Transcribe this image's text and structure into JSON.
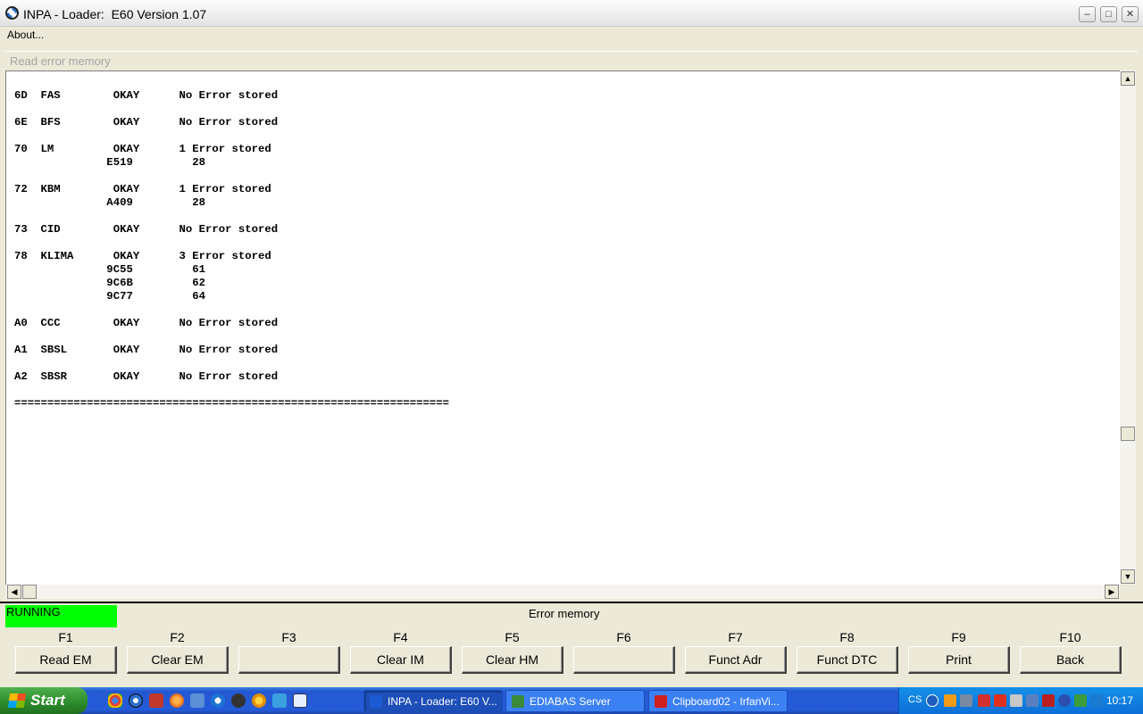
{
  "window": {
    "title": "INPA - Loader:  E60 Version 1.07"
  },
  "menu": {
    "about": "About..."
  },
  "panel": {
    "title": "Read error memory"
  },
  "output_lines": [
    "6D  FAS        OKAY      No Error stored",
    "",
    "6E  BFS        OKAY      No Error stored",
    "",
    "70  LM         OKAY      1 Error stored",
    "              E519         28",
    "",
    "72  KBM        OKAY      1 Error stored",
    "              A409         28",
    "",
    "73  CID        OKAY      No Error stored",
    "",
    "78  KLIMA      OKAY      3 Error stored",
    "              9C55         61",
    "              9C6B         62",
    "              9C77         64",
    "",
    "A0  CCC        OKAY      No Error stored",
    "",
    "A1  SBSL       OKAY      No Error stored",
    "",
    "A2  SBSR       OKAY      No Error stored",
    "",
    "=================================================================="
  ],
  "status": {
    "state": "RUNNING",
    "title": "Error memory"
  },
  "function_keys": [
    {
      "key": "F1",
      "label": "Read EM"
    },
    {
      "key": "F2",
      "label": "Clear EM"
    },
    {
      "key": "F3",
      "label": ""
    },
    {
      "key": "F4",
      "label": "Clear IM"
    },
    {
      "key": "F5",
      "label": "Clear HM"
    },
    {
      "key": "F6",
      "label": ""
    },
    {
      "key": "F7",
      "label": "Funct Adr"
    },
    {
      "key": "F8",
      "label": "Funct DTC"
    },
    {
      "key": "F9",
      "label": "Print"
    },
    {
      "key": "F10",
      "label": "Back"
    }
  ],
  "taskbar": {
    "start": "Start",
    "tasks": [
      {
        "label": "INPA - Loader:  E60 V...",
        "active": true,
        "icon": "bmw-icon"
      },
      {
        "label": "EDIABAS Server",
        "active": false,
        "icon": "ediabas-icon"
      },
      {
        "label": "Clipboard02 - IrfanVi...",
        "active": false,
        "icon": "irfanview-icon"
      }
    ],
    "tray_lang": "CS",
    "clock": "10:17"
  }
}
